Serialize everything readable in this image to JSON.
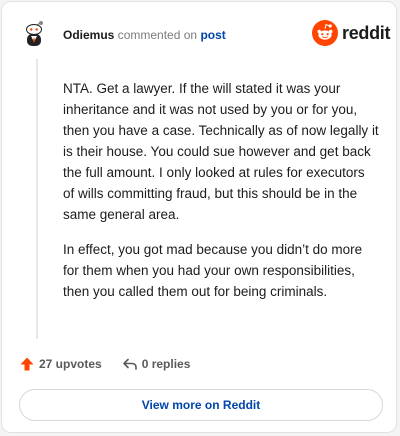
{
  "header": {
    "username": "Odiemus",
    "action_text": "commented on",
    "target_link": "post"
  },
  "brand": {
    "wordmark": "reddit",
    "logo_icon": "reddit-snoo-icon",
    "accent": "#ff4500"
  },
  "comment": {
    "paragraphs": [
      "NTA. Get a lawyer. If the will stated it was your inheritance and it was not used by you or for you, then you have a case. Technically as of now legally it is their house. You could sue however and get back the full amount. I only looked at rules for executors of wills committing fraud, but this should be in the same general area.",
      "In effect, you got mad because you didn’t do more for them when you had your own responsibilities, then you called them out for being criminals."
    ]
  },
  "stats": {
    "upvotes": "27 upvotes",
    "replies": "0 replies",
    "upvote_icon": "upvote-arrow-icon",
    "reply_icon": "reply-arrow-icon"
  },
  "footer": {
    "view_more": "View more on Reddit"
  }
}
